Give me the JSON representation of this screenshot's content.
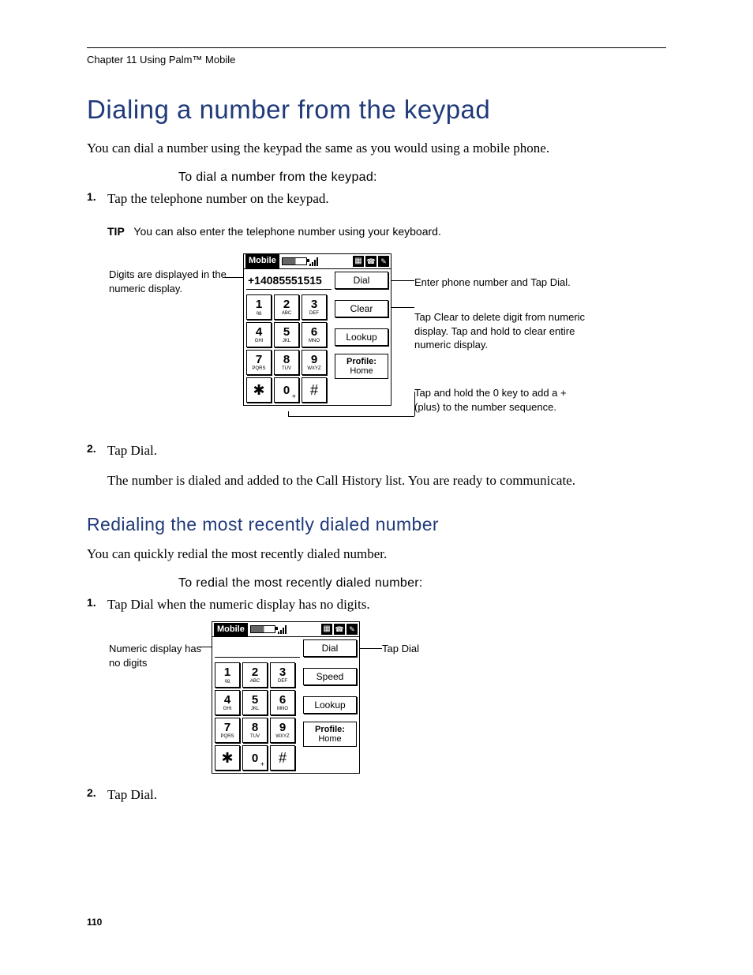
{
  "header": {
    "chapter": "Chapter 11    Using Palm™  Mobile"
  },
  "section1": {
    "title": "Dialing a number from the keypad",
    "intro": "You can dial a number using the keypad the same as you would using a mobile phone.",
    "proc_heading": "To dial a number from the keypad:",
    "step1": "Tap the telephone number on the keypad.",
    "tip_label": "TIP",
    "tip_text": "You can also enter the telephone number using your keyboard.",
    "step2": "Tap Dial.",
    "step2_body": "The number is dialed and added to the Call History list. You are ready to communicate."
  },
  "section2": {
    "title": "Redialing the most recently dialed number",
    "intro": "You can quickly redial the most recently dialed number.",
    "proc_heading": "To redial the most recently dialed number:",
    "step1": "Tap Dial when the numeric display has no digits.",
    "step2": "Tap Dial."
  },
  "callouts1": {
    "left": "Digits are displayed in the numeric display.",
    "right_dial": "Enter phone number and Tap Dial.",
    "right_clear": "Tap Clear to delete digit from numeric display. Tap and hold to clear entire numeric display.",
    "right_zero": "Tap and hold the 0 key to add a + (plus) to the number sequence."
  },
  "callouts2": {
    "left": "Numeric display has no digits",
    "right": "Tap Dial"
  },
  "device1": {
    "app_label": "Mobile",
    "display": "+14085551515",
    "side": {
      "dial": "Dial",
      "clear": "Clear",
      "lookup": "Lookup",
      "profile_label": "Profile:",
      "profile_value": "Home"
    }
  },
  "device2": {
    "app_label": "Mobile",
    "display": "",
    "side": {
      "dial": "Dial",
      "speed": "Speed",
      "lookup": "Lookup",
      "profile_label": "Profile:",
      "profile_value": "Home"
    }
  },
  "keys": {
    "k1d": "1",
    "k1s": "ᴏ͟ᴏ",
    "k2d": "2",
    "k2s": "ABC",
    "k3d": "3",
    "k3s": "DEF",
    "k4d": "4",
    "k4s": "GHI",
    "k5d": "5",
    "k5s": "JKL",
    "k6d": "6",
    "k6s": "MNO",
    "k7d": "7",
    "k7s": "PQRS",
    "k8d": "8",
    "k8s": "TUV",
    "k9d": "9",
    "k9s": "WXYZ",
    "kstard": "✱",
    "kstars": "",
    "k0d": "0",
    "k0s": "+",
    "khashd": "#",
    "khashs": ""
  },
  "page_number": "110"
}
